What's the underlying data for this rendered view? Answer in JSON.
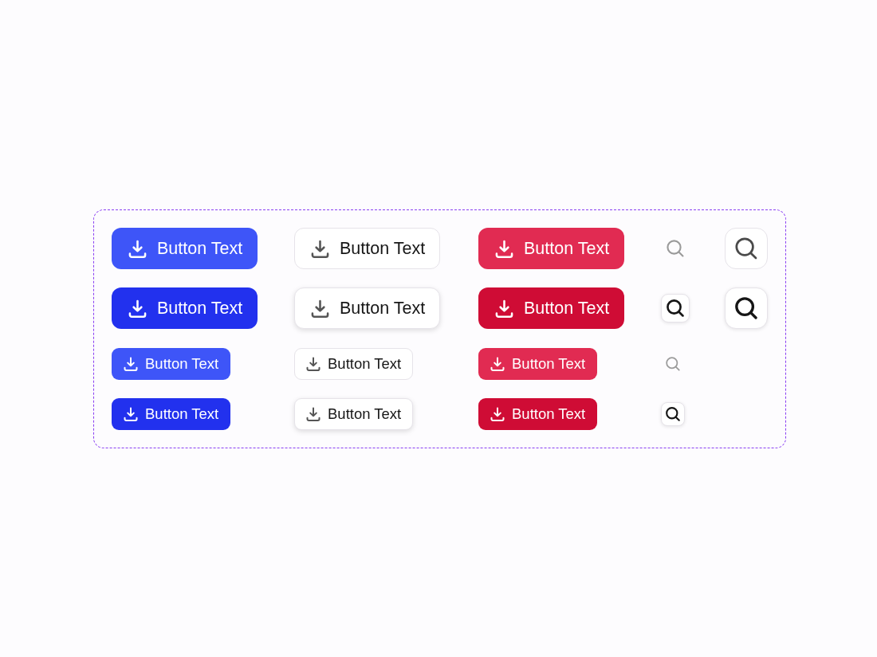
{
  "showcase": {
    "groups": [
      {
        "kind": "large",
        "rows": [
          {
            "buttons": [
              {
                "kind": "primary",
                "hovered": false,
                "label": "Button Text"
              },
              {
                "kind": "secondary",
                "hovered": false,
                "label": "Button Text"
              },
              {
                "kind": "danger",
                "hovered": false,
                "label": "Button Text"
              },
              {
                "kind": "ghost",
                "hovered": false
              },
              {
                "kind": "icon",
                "hovered": false
              }
            ]
          },
          {
            "buttons": [
              {
                "kind": "primary",
                "hovered": true,
                "label": "Button Text"
              },
              {
                "kind": "secondary",
                "hovered": true,
                "label": "Button Text"
              },
              {
                "kind": "danger",
                "hovered": true,
                "label": "Button Text"
              },
              {
                "kind": "ghost",
                "hovered": true
              },
              {
                "kind": "icon",
                "hovered": true
              }
            ]
          }
        ]
      },
      {
        "kind": "small",
        "rows": [
          {
            "buttons": [
              {
                "kind": "primary",
                "hovered": false,
                "label": "Button Text"
              },
              {
                "kind": "secondary",
                "hovered": false,
                "label": "Button Text"
              },
              {
                "kind": "danger",
                "hovered": false,
                "label": "Button Text"
              },
              {
                "kind": "ghost",
                "hovered": false
              }
            ]
          },
          {
            "buttons": [
              {
                "kind": "primary",
                "hovered": true,
                "label": "Button Text"
              },
              {
                "kind": "secondary",
                "hovered": true,
                "label": "Button Text"
              },
              {
                "kind": "danger",
                "hovered": true,
                "label": "Button Text"
              },
              {
                "kind": "ghost",
                "hovered": true
              }
            ]
          }
        ]
      }
    ]
  }
}
